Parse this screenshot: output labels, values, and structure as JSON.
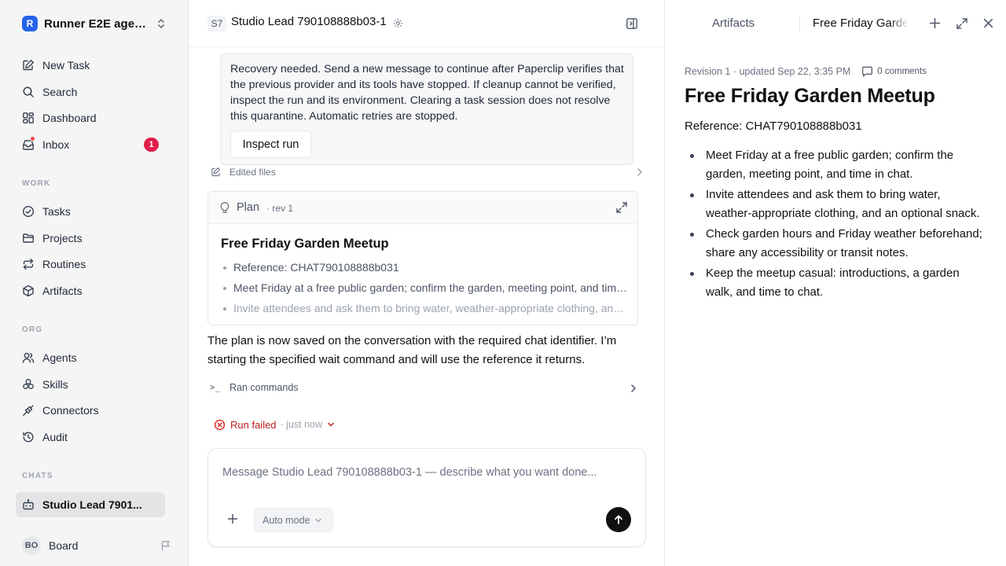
{
  "sidebar": {
    "workspace": {
      "logo": "R",
      "name": "Runner E2E agen..."
    },
    "top_items": [
      {
        "label": "New Task",
        "icon": "edit-icon"
      },
      {
        "label": "Search",
        "icon": "search-icon"
      },
      {
        "label": "Dashboard",
        "icon": "dashboard-icon"
      },
      {
        "label": "Inbox",
        "icon": "inbox-icon",
        "badge": "1"
      }
    ],
    "work_label": "WORK",
    "work_items": [
      {
        "label": "Tasks",
        "icon": "check-circle-icon"
      },
      {
        "label": "Projects",
        "icon": "folder-icon"
      },
      {
        "label": "Routines",
        "icon": "repeat-icon"
      },
      {
        "label": "Artifacts",
        "icon": "box-icon"
      }
    ],
    "org_label": "ORG",
    "org_items": [
      {
        "label": "Agents",
        "icon": "users-icon"
      },
      {
        "label": "Skills",
        "icon": "skills-icon"
      },
      {
        "label": "Connectors",
        "icon": "plug-icon"
      },
      {
        "label": "Audit",
        "icon": "history-icon"
      }
    ],
    "chats_label": "CHATS",
    "chat_items": [
      {
        "label": "Studio Lead 7901...",
        "icon": "bot-icon",
        "active": true
      }
    ],
    "board": {
      "initials": "BO",
      "label": "Board"
    }
  },
  "main": {
    "header": {
      "chip": "S7",
      "title": "Studio Lead 790108888b03-1"
    },
    "alert": {
      "text": "Recovery needed. Send a new message to continue after Paperclip verifies that the previous provider and its tools have stopped. If cleanup cannot be verified, inspect the run and its environment. Clearing a task session does not resolve this quarantine. Automatic retries are stopped.",
      "button": "Inspect run"
    },
    "edited_files": "Edited files",
    "plan": {
      "label": "Plan",
      "rev": "· rev 1",
      "title": "Free Friday Garden Meetup",
      "items": [
        "Reference: CHAT790108888b031",
        "Meet Friday at a free public garden; confirm the garden, meeting point, and time in chat.",
        "Invite attendees and ask them to bring water, weather-appropriate clothing, and an optional snack."
      ]
    },
    "message": "The plan is now saved on the conversation with the required chat identifier. I’m starting the specified wait command and will use the reference it returns.",
    "ran_commands": "Ran commands",
    "ran_prompt": ">_",
    "run_status": {
      "label": "Run failed",
      "when": "· just now",
      "color": "#dc2626"
    },
    "composer": {
      "placeholder": "Message Studio Lead 790108888b03-1 — describe what you want done...",
      "value": "",
      "mode": "Auto mode"
    }
  },
  "right": {
    "tabs": [
      "Artifacts",
      "Free Friday Garden Meetup"
    ],
    "meta": "Revision 1 · updated Sep 22, 3:35 PM",
    "comments": "0 comments",
    "title": "Free Friday Garden Meetup",
    "reference": "Reference: CHAT790108888b031",
    "items": [
      "Meet Friday at a free public garden; confirm the garden, meeting point, and time in chat.",
      "Invite attendees and ask them to bring water, weather-appropriate clothing, and an optional snack.",
      "Check garden hours and Friday weather beforehand; share any accessibility or transit notes.",
      "Keep the meetup casual: introductions, a garden walk, and time to chat."
    ]
  }
}
